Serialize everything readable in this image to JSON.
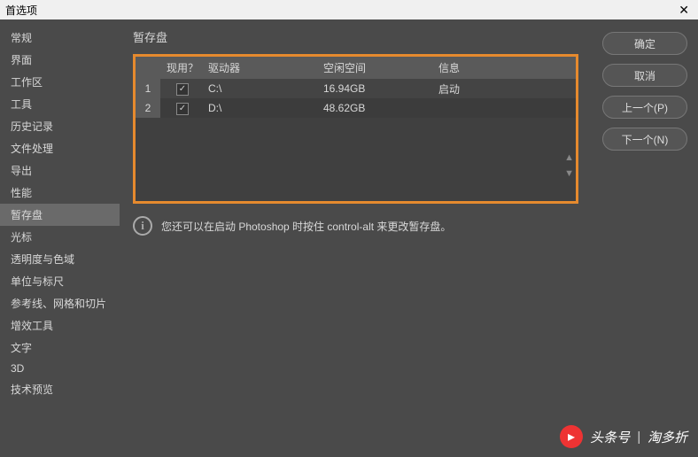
{
  "window": {
    "title": "首选项"
  },
  "sidebar": {
    "items": [
      {
        "label": "常规"
      },
      {
        "label": "界面"
      },
      {
        "label": "工作区"
      },
      {
        "label": "工具"
      },
      {
        "label": "历史记录"
      },
      {
        "label": "文件处理"
      },
      {
        "label": "导出"
      },
      {
        "label": "性能"
      },
      {
        "label": "暂存盘"
      },
      {
        "label": "光标"
      },
      {
        "label": "透明度与色域"
      },
      {
        "label": "单位与标尺"
      },
      {
        "label": "参考线、网格和切片"
      },
      {
        "label": "增效工具"
      },
      {
        "label": "文字"
      },
      {
        "label": "3D"
      },
      {
        "label": "技术预览"
      }
    ],
    "active_index": 8
  },
  "panel": {
    "title": "暂存盘",
    "headers": {
      "use": "现用？",
      "drive": "驱动器",
      "free": "空闲空间",
      "info": "信息"
    },
    "rows": [
      {
        "num": "1",
        "checked": true,
        "drive": "C:\\",
        "free": "16.94GB",
        "info": "启动"
      },
      {
        "num": "2",
        "checked": true,
        "drive": "D:\\",
        "free": "48.62GB",
        "info": ""
      }
    ],
    "hint": "您还可以在启动 Photoshop 时按住 control-alt 来更改暂存盘。"
  },
  "buttons": {
    "ok": "确定",
    "cancel": "取消",
    "prev": "上一个(P)",
    "next": "下一个(N)"
  },
  "watermark": {
    "source": "头条号",
    "name": "淘多折"
  }
}
